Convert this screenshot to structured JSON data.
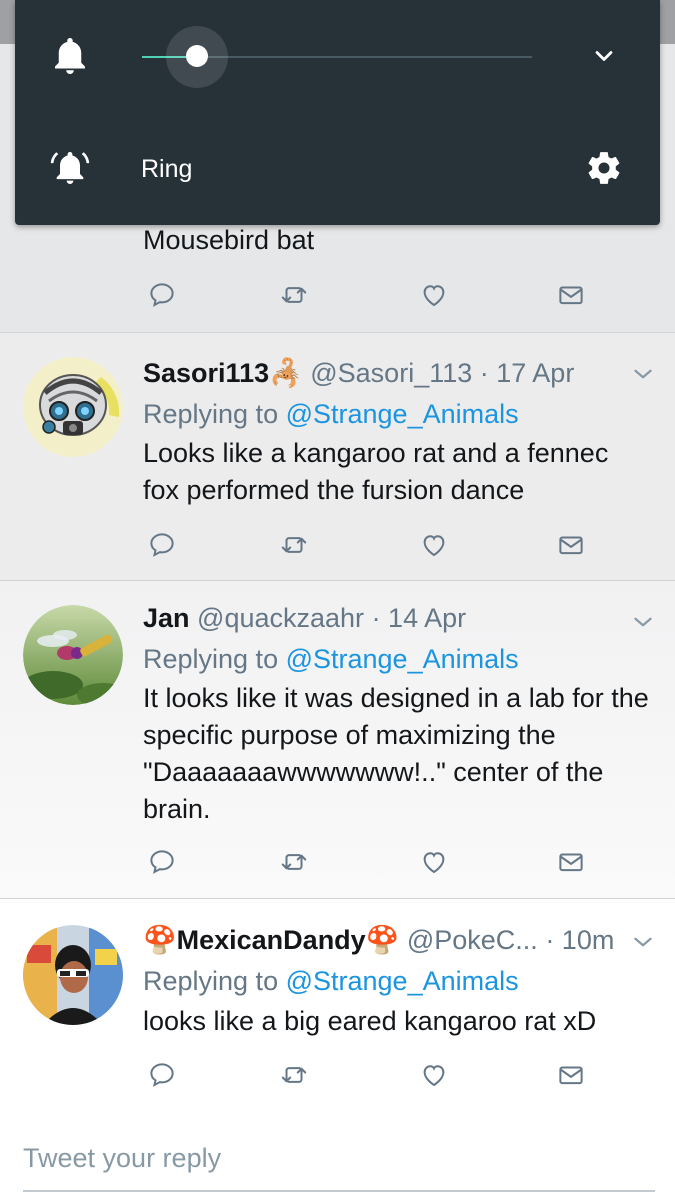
{
  "volume_panel": {
    "level_fraction": 0.14,
    "mode_label": "Ring",
    "accent_color": "#4fd1b5",
    "icons": [
      "bell-icon",
      "chevron-down-icon",
      "ringing-bell-icon",
      "gear-icon"
    ]
  },
  "partial_tweet": {
    "text": "Mousebird bat"
  },
  "tweets": [
    {
      "display_name": "Sasori113",
      "emoji": "🦂",
      "handle": "@Sasori_113",
      "time": "· 17 Apr",
      "replying_prefix": "Replying to ",
      "replying_to": "@Strange_Animals",
      "text": "Looks like a kangaroo rat and a fennec fox performed the fursion dance"
    },
    {
      "display_name": "Jan",
      "handle": "@quackzaahr",
      "time": "· 14 Apr",
      "replying_prefix": "Replying to ",
      "replying_to": "@Strange_Animals",
      "text": "It looks like it was designed in a lab for the specific purpose of maximizing the \"Daaaaaaawwwwwww!..\" center of the brain."
    },
    {
      "display_name": "MexicanDandy",
      "emoji": "🍄",
      "handle": "@PokeC...",
      "time": "· 10m",
      "replying_prefix": "Replying to ",
      "replying_to": "@Strange_Animals",
      "text": "looks like a big eared kangaroo rat xD"
    }
  ],
  "compose": {
    "placeholder": "Tweet your reply"
  },
  "colors": {
    "panel_bg": "#263238",
    "link": "#1b95e0",
    "muted": "#657786",
    "icon": "#657786"
  }
}
